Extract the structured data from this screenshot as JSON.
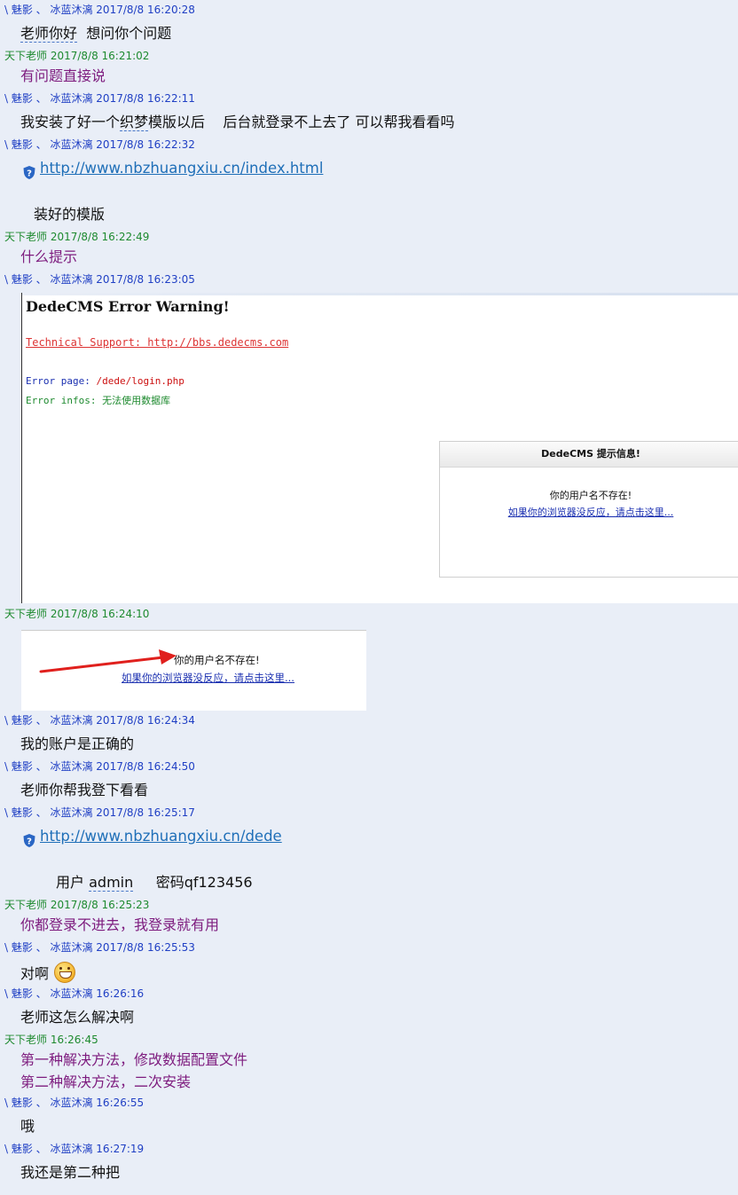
{
  "users": {
    "student": "\\ 魅影 、 冰蓝沐漓",
    "teacher": "天下老师"
  },
  "messages": [
    {
      "header": "\\ 魅影 、 冰蓝沐漓 2017/8/8 16:20:28",
      "text_a": "老师你好",
      "text_b": "想问你个问题"
    },
    {
      "header": "天下老师 2017/8/8 16:21:02",
      "text": "有问题直接说"
    },
    {
      "header": "\\ 魅影 、 冰蓝沐漓 2017/8/8 16:22:11",
      "text_a": "我安装了好一个",
      "text_b": "织梦",
      "text_c": "模版以后",
      "text_d": "后台就登录不上去了  可以帮我看看吗"
    },
    {
      "header": "\\ 魅影 、 冰蓝沐漓 2017/8/8 16:22:32",
      "link": "http://www.nbzhuangxiu.cn/index.html",
      "text": "装好的模版"
    },
    {
      "header": "天下老师 2017/8/8 16:22:49",
      "text": "什么提示"
    },
    {
      "header": "\\ 魅影 、 冰蓝沐漓 2017/8/8 16:23:05"
    },
    {
      "header": "天下老师 2017/8/8 16:24:10"
    },
    {
      "header": "\\ 魅影 、 冰蓝沐漓 2017/8/8 16:24:34",
      "text": "我的账户是正确的"
    },
    {
      "header": "\\ 魅影 、 冰蓝沐漓 2017/8/8 16:24:50",
      "text": "老师你帮我登下看看"
    },
    {
      "header": "\\ 魅影 、 冰蓝沐漓 2017/8/8 16:25:17",
      "link": "http://www.nbzhuangxiu.cn/dede",
      "text_a": "用户",
      "text_b": "admin",
      "text_c": "密码qf123456"
    },
    {
      "header": "天下老师 2017/8/8 16:25:23",
      "text": "你都登录不进去，我登录就有用"
    },
    {
      "header": "\\ 魅影 、 冰蓝沐漓 2017/8/8 16:25:53",
      "text": "对啊",
      "emoji": "grinning-face"
    },
    {
      "header": "\\ 魅影 、 冰蓝沐漓  16:26:16",
      "text": "老师这怎么解决啊"
    },
    {
      "header": "天下老师  16:26:45",
      "text_a": "第一种解决方法，修改数据配置文件",
      "text_b": "第二种解决方法，二次安装"
    },
    {
      "header": "\\ 魅影 、 冰蓝沐漓  16:26:55",
      "text": "哦"
    },
    {
      "header": "\\ 魅影 、 冰蓝沐漓  16:27:19",
      "text": "我还是第二种把"
    }
  ],
  "screenshot_error": {
    "title": "DedeCMS Error Warning!",
    "support": "Technical Support: http://bbs.dedecms.com",
    "page_label": "Error page: ",
    "page_value": "/dede/login.php",
    "info_label": "Error infos: ",
    "info_value": "无法使用数据库",
    "box_title": "DedeCMS 提示信息!",
    "box_line1": "你的用户名不存在!",
    "box_line2": "如果你的浏览器没反应，请点击这里..."
  },
  "screenshot_annotated": {
    "line1": "你的用户名不存在!",
    "line2": "如果你的浏览器没反应，请点击这里..."
  },
  "colors": {
    "background": "#e9eef7",
    "student_header": "#1f3fc4",
    "teacher_header": "#1e8a2f",
    "teacher_text": "#7d1b7e",
    "link": "#1f6fb8"
  }
}
